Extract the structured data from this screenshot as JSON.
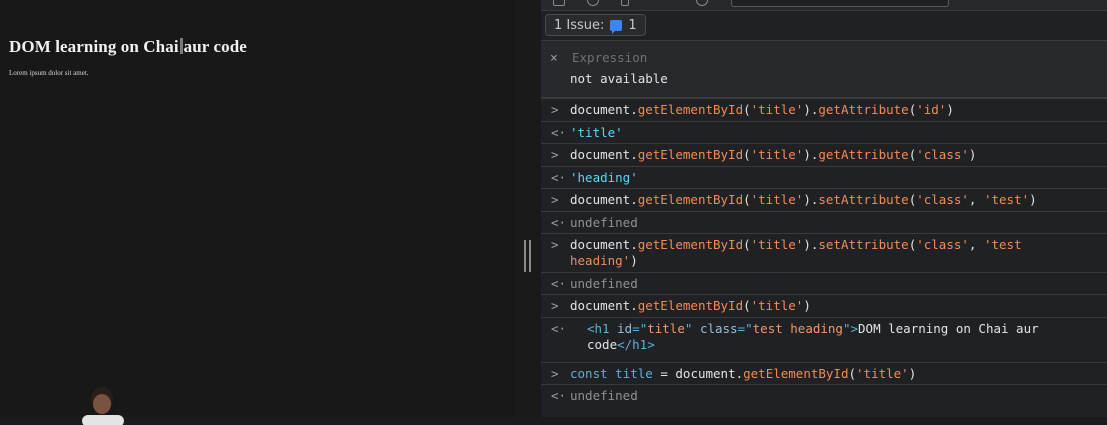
{
  "page": {
    "heading_before_cursor": "DOM learning on Chai",
    "heading_after_cursor": "aur code",
    "paragraph": "Lorem ipsum dolor sit amet."
  },
  "devtools": {
    "issues": {
      "label": "1 Issue:",
      "count": "1"
    },
    "expression": {
      "close": "×",
      "label": "Expression",
      "value": "not available"
    },
    "console": [
      {
        "type": "input",
        "parts": [
          [
            "plain",
            "document."
          ],
          [
            "fn",
            "getElementById"
          ],
          [
            "plain",
            "("
          ],
          [
            "str",
            "'title'"
          ],
          [
            "plain",
            ")."
          ],
          [
            "fn",
            "getAttribute"
          ],
          [
            "plain",
            "("
          ],
          [
            "str",
            "'id'"
          ],
          [
            "plain",
            ")"
          ]
        ]
      },
      {
        "type": "result",
        "parts": [
          [
            "strres",
            "'title'"
          ]
        ]
      },
      {
        "type": "input",
        "parts": [
          [
            "plain",
            "document."
          ],
          [
            "fn",
            "getElementById"
          ],
          [
            "plain",
            "("
          ],
          [
            "str",
            "'title'"
          ],
          [
            "plain",
            ")."
          ],
          [
            "fn",
            "getAttribute"
          ],
          [
            "plain",
            "("
          ],
          [
            "str",
            "'class'"
          ],
          [
            "plain",
            ")"
          ]
        ]
      },
      {
        "type": "result",
        "parts": [
          [
            "strres",
            "'heading'"
          ]
        ]
      },
      {
        "type": "input",
        "parts": [
          [
            "plain",
            "document."
          ],
          [
            "fn",
            "getElementById"
          ],
          [
            "plain",
            "("
          ],
          [
            "str",
            "'title'"
          ],
          [
            "plain",
            ")."
          ],
          [
            "fn",
            "setAttribute"
          ],
          [
            "plain",
            "("
          ],
          [
            "str",
            "'class'"
          ],
          [
            "plain",
            ", "
          ],
          [
            "str",
            "'test'"
          ],
          [
            "plain",
            ")"
          ]
        ]
      },
      {
        "type": "result",
        "parts": [
          [
            "undef",
            "undefined"
          ]
        ]
      },
      {
        "type": "input",
        "parts": [
          [
            "plain",
            "document."
          ],
          [
            "fn",
            "getElementById"
          ],
          [
            "plain",
            "("
          ],
          [
            "str",
            "'title'"
          ],
          [
            "plain",
            ")."
          ],
          [
            "fn",
            "setAttribute"
          ],
          [
            "plain",
            "("
          ],
          [
            "str",
            "'class'"
          ],
          [
            "plain",
            ", "
          ],
          [
            "str",
            "'test\nheading'"
          ],
          [
            "plain",
            ")"
          ]
        ]
      },
      {
        "type": "result",
        "parts": [
          [
            "undef",
            "undefined"
          ]
        ]
      },
      {
        "type": "input",
        "parts": [
          [
            "plain",
            "document."
          ],
          [
            "fn",
            "getElementById"
          ],
          [
            "plain",
            "("
          ],
          [
            "str",
            "'title'"
          ],
          [
            "plain",
            ")"
          ]
        ]
      },
      {
        "type": "result-element",
        "parts": [
          [
            "tag",
            "<h1 "
          ],
          [
            "attr",
            "id"
          ],
          [
            "tag",
            "=\""
          ],
          [
            "attrv",
            "title"
          ],
          [
            "tag",
            "\" "
          ],
          [
            "attr",
            "class"
          ],
          [
            "tag",
            "=\""
          ],
          [
            "attrv",
            "test heading"
          ],
          [
            "tag",
            "\">"
          ],
          [
            "plain",
            "DOM learning on Chai aur\ncode"
          ],
          [
            "tag",
            "</h1>"
          ]
        ]
      },
      {
        "type": "input",
        "parts": [
          [
            "kw",
            "const"
          ],
          [
            "plain",
            " "
          ],
          [
            "kw",
            "title"
          ],
          [
            "plain",
            " = document."
          ],
          [
            "fn",
            "getElementById"
          ],
          [
            "plain",
            "("
          ],
          [
            "str",
            "'title'"
          ],
          [
            "plain",
            ")"
          ]
        ]
      },
      {
        "type": "result",
        "parts": [
          [
            "undef",
            "undefined"
          ]
        ]
      }
    ],
    "arrows": {
      "input": ">",
      "result": "<·"
    }
  }
}
